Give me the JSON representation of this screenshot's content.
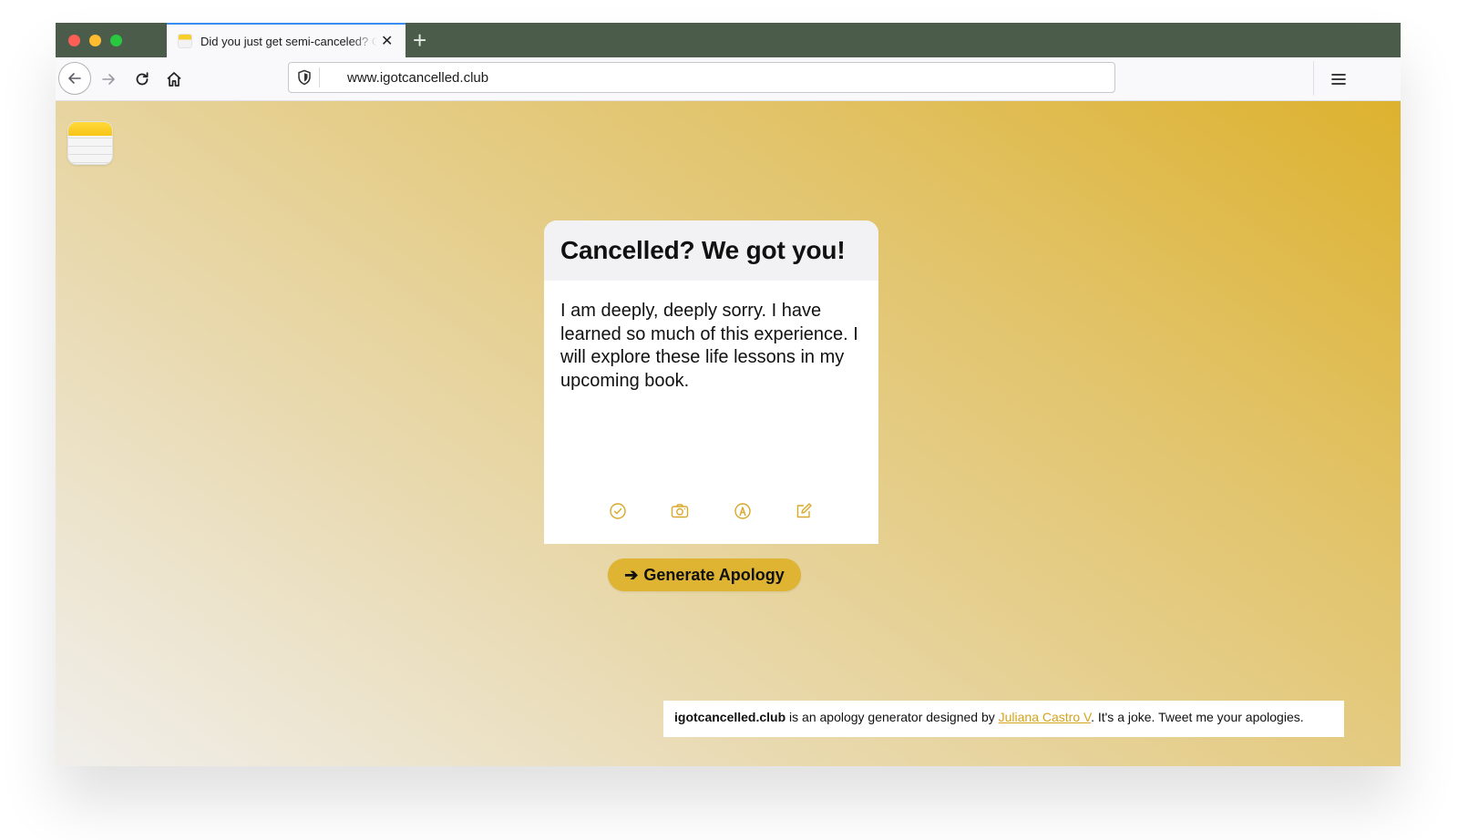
{
  "browser": {
    "tab_title": "Did you just get semi-canceled? Ge",
    "tab_close": "✕",
    "new_tab": "+",
    "url": "www.igotcancelled.club",
    "menu_icon": "hamburger-menu-icon"
  },
  "card": {
    "title": "Cancelled? We got you!",
    "apology_text": "I am deeply, deeply sorry. I have learned so much of this experience. I will explore these life lessons in my upcoming book.",
    "tools": [
      "check-circle-icon",
      "camera-icon",
      "markup-icon",
      "compose-icon"
    ]
  },
  "generate_button": {
    "arrow": "➔",
    "label": "Generate Apology"
  },
  "footer": {
    "site_name": "igotcancelled.club",
    "text_1": " is an apology generator designed by ",
    "author_link": "Juliana Castro V",
    "text_2": ". It's a joke. Tweet me your apologies."
  },
  "colors": {
    "accent": "#deb432",
    "link": "#d4a41a",
    "tabbar": "#4b5d4a"
  }
}
